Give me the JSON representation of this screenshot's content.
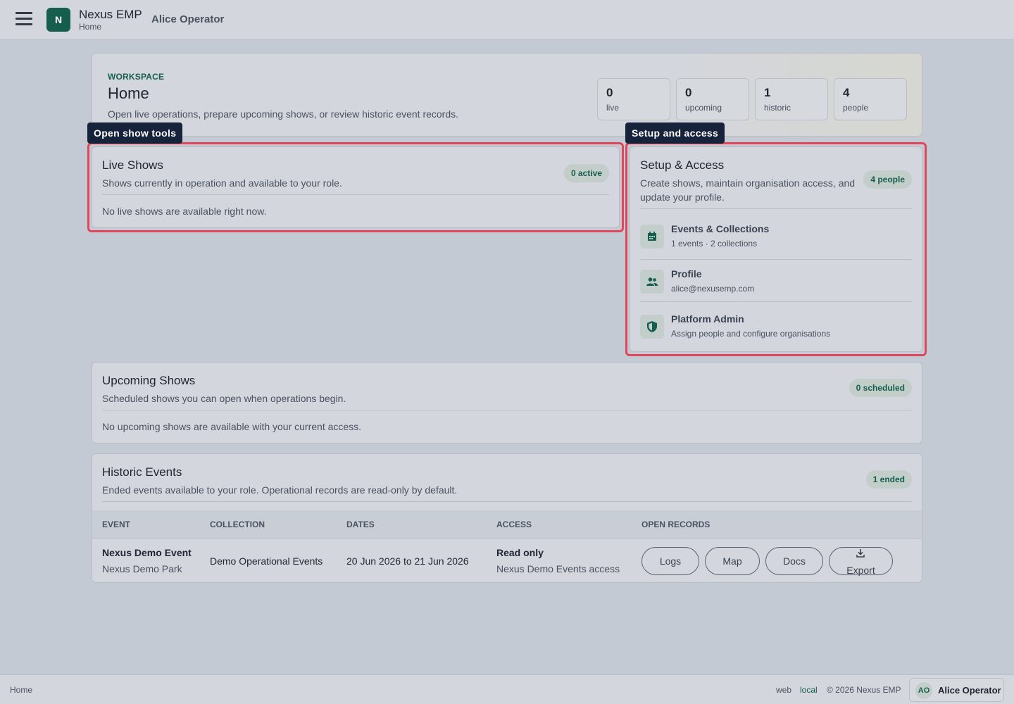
{
  "header": {
    "logo_letter": "N",
    "app_name": "Nexus EMP",
    "breadcrumb": "Home",
    "user": "Alice Operator"
  },
  "hero": {
    "eyebrow": "WORKSPACE",
    "title": "Home",
    "description": "Open live operations, prepare upcoming shows, or review historic event records.",
    "stats": [
      {
        "value": "0",
        "label": "live"
      },
      {
        "value": "0",
        "label": "upcoming"
      },
      {
        "value": "1",
        "label": "historic"
      },
      {
        "value": "4",
        "label": "people"
      }
    ]
  },
  "tooltips": {
    "live": "Open show tools",
    "setup": "Setup and access"
  },
  "live_shows": {
    "title": "Live Shows",
    "description": "Shows currently in operation and available to your role.",
    "badge": "0 active",
    "empty": "No live shows are available right now."
  },
  "setup": {
    "title": "Setup & Access",
    "description": "Create shows, maintain organisation access, and update your profile.",
    "badge": "4 people",
    "items": [
      {
        "icon": "calendar-icon",
        "name": "Events & Collections",
        "sub": "1 events · 2 collections"
      },
      {
        "icon": "people-icon",
        "name": "Profile",
        "sub": "alice@nexusemp.com"
      },
      {
        "icon": "shield-icon",
        "name": "Platform Admin",
        "sub": "Assign people and configure organisations"
      }
    ]
  },
  "upcoming": {
    "title": "Upcoming Shows",
    "description": "Scheduled shows you can open when operations begin.",
    "badge": "0 scheduled",
    "empty": "No upcoming shows are available with your current access."
  },
  "historic": {
    "title": "Historic Events",
    "description": "Ended events available to your role. Operational records are read-only by default.",
    "badge": "1 ended",
    "columns": [
      "EVENT",
      "COLLECTION",
      "DATES",
      "ACCESS",
      "OPEN RECORDS"
    ],
    "rows": [
      {
        "event": "Nexus Demo Event",
        "venue": "Nexus Demo Park",
        "collection": "Demo Operational Events",
        "dates": "20 Jun 2026 to 21 Jun 2026",
        "access": "Read only",
        "access_scope": "Nexus Demo Events access",
        "actions": [
          "Logs",
          "Map",
          "Docs",
          "Export"
        ]
      }
    ]
  },
  "footer": {
    "breadcrumb": "Home",
    "env_web": "web",
    "env_local": "local",
    "copyright": "© 2026 Nexus EMP",
    "avatar": "AO",
    "user": "Alice Operator"
  },
  "colors": {
    "brand": "#155e4e",
    "highlight": "#e0475b",
    "tooltip_bg": "#17233a"
  }
}
